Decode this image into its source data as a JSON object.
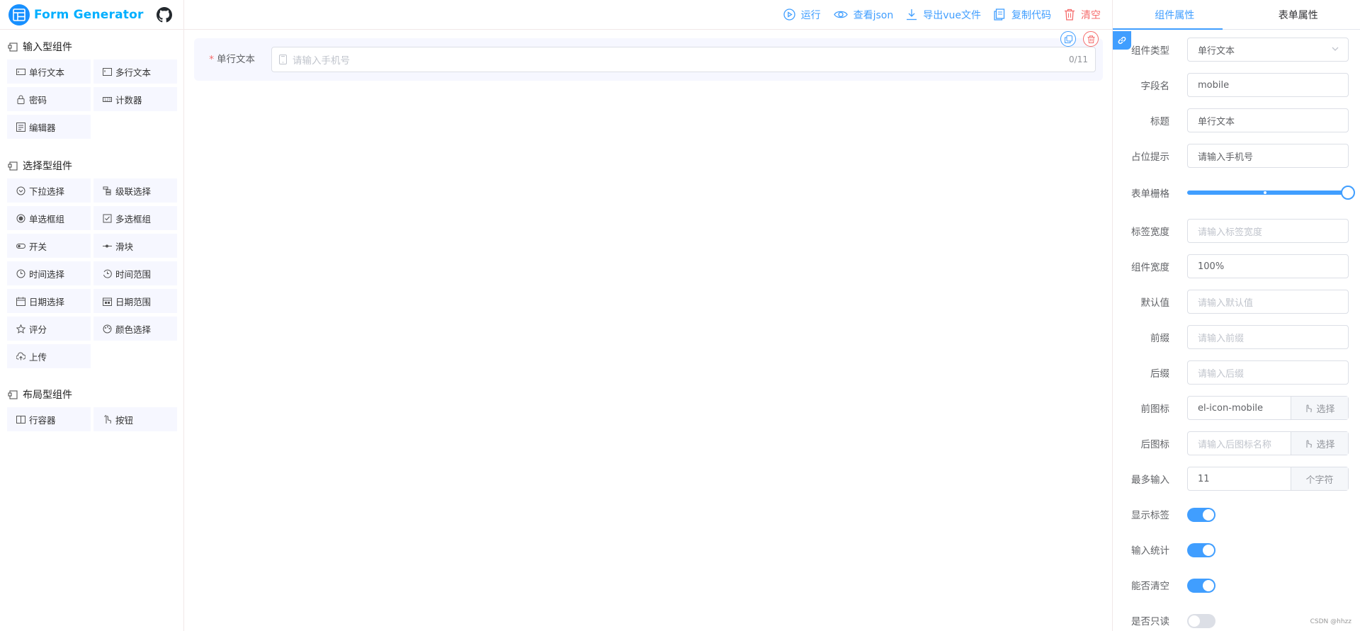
{
  "app": {
    "title": "Form Generator"
  },
  "sidebar": {
    "groups": [
      {
        "title": "输入型组件",
        "items": [
          {
            "label": "单行文本",
            "icon": "input-icon"
          },
          {
            "label": "多行文本",
            "icon": "textarea-icon"
          },
          {
            "label": "密码",
            "icon": "password-icon"
          },
          {
            "label": "计数器",
            "icon": "number-icon"
          },
          {
            "label": "编辑器",
            "icon": "editor-icon"
          }
        ]
      },
      {
        "title": "选择型组件",
        "items": [
          {
            "label": "下拉选择",
            "icon": "select-icon"
          },
          {
            "label": "级联选择",
            "icon": "cascader-icon"
          },
          {
            "label": "单选框组",
            "icon": "radio-icon"
          },
          {
            "label": "多选框组",
            "icon": "checkbox-icon"
          },
          {
            "label": "开关",
            "icon": "switch-icon"
          },
          {
            "label": "滑块",
            "icon": "slider-icon"
          },
          {
            "label": "时间选择",
            "icon": "time-icon"
          },
          {
            "label": "时间范围",
            "icon": "time-range-icon"
          },
          {
            "label": "日期选择",
            "icon": "date-icon"
          },
          {
            "label": "日期范围",
            "icon": "date-range-icon"
          },
          {
            "label": "评分",
            "icon": "rate-icon"
          },
          {
            "label": "颜色选择",
            "icon": "color-icon"
          },
          {
            "label": "上传",
            "icon": "upload-icon"
          }
        ]
      },
      {
        "title": "布局型组件",
        "items": [
          {
            "label": "行容器",
            "icon": "row-icon"
          },
          {
            "label": "按钮",
            "icon": "button-icon"
          }
        ]
      }
    ]
  },
  "toolbar": {
    "run": "运行",
    "view_json": "查看json",
    "export_vue": "导出vue文件",
    "copy_code": "复制代码",
    "clear": "清空"
  },
  "canvas": {
    "field": {
      "label": "单行文本",
      "required_mark": "*",
      "placeholder": "请输入手机号",
      "count": "0/11"
    }
  },
  "right_panel": {
    "tabs": [
      "组件属性",
      "表单属性"
    ],
    "props": {
      "component_type": {
        "label": "组件类型",
        "value": "单行文本"
      },
      "field_name": {
        "label": "字段名",
        "value": "mobile"
      },
      "title": {
        "label": "标题",
        "value": "单行文本"
      },
      "placeholder": {
        "label": "占位提示",
        "value": "请输入手机号"
      },
      "span": {
        "label": "表单栅格",
        "value": 24,
        "max": 24
      },
      "label_width": {
        "label": "标签宽度",
        "placeholder": "请输入标签宽度"
      },
      "width": {
        "label": "组件宽度",
        "value": "100%"
      },
      "default_value": {
        "label": "默认值",
        "placeholder": "请输入默认值"
      },
      "prefix": {
        "label": "前缀",
        "placeholder": "请输入前缀"
      },
      "suffix": {
        "label": "后缀",
        "placeholder": "请输入后缀"
      },
      "prefix_icon": {
        "label": "前图标",
        "value": "el-icon-mobile",
        "button": "选择"
      },
      "suffix_icon": {
        "label": "后图标",
        "placeholder": "请输入后图标名称",
        "button": "选择"
      },
      "maxlength": {
        "label": "最多输入",
        "value": "11",
        "append": "个字符"
      },
      "show_label": {
        "label": "显示标签",
        "on": true
      },
      "show_word_limit": {
        "label": "输入统计",
        "on": true
      },
      "clearable": {
        "label": "能否清空",
        "on": true
      },
      "readonly": {
        "label": "是否只读",
        "on": false
      }
    }
  },
  "watermark": "CSDN @hhzz",
  "colors": {
    "primary": "#409eff",
    "danger": "#f56c6c",
    "item_bg": "#f6f7ff"
  }
}
